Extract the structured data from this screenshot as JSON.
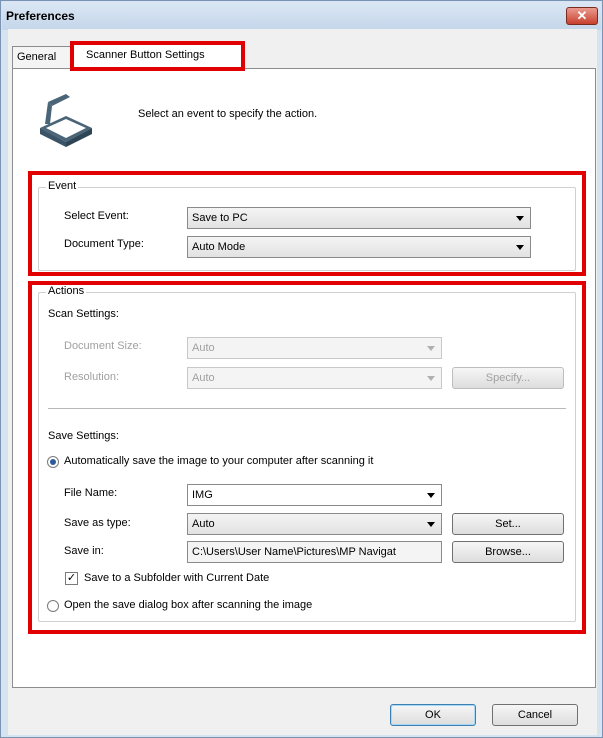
{
  "window": {
    "title": "Preferences",
    "close_glyph": "✕"
  },
  "tabs": [
    {
      "label": "General",
      "active": false
    },
    {
      "label": "Scanner Button Settings",
      "active": true
    }
  ],
  "intro": {
    "icon": "scanner-icon",
    "text": "Select an event to specify the action."
  },
  "event": {
    "group_title": "Event",
    "select_event_label": "Select Event:",
    "select_event_value": "Save to PC",
    "document_type_label": "Document Type:",
    "document_type_value": "Auto Mode"
  },
  "actions": {
    "group_title": "Actions",
    "scan_settings_label": "Scan Settings:",
    "document_size_label": "Document Size:",
    "document_size_value": "Auto",
    "resolution_label": "Resolution:",
    "resolution_value": "Auto",
    "specify_label": "Specify...",
    "save_settings_label": "Save Settings:",
    "auto_save_label": "Automatically save the image to your computer after scanning it",
    "file_name_label": "File Name:",
    "file_name_value": "IMG",
    "save_as_type_label": "Save as type:",
    "save_as_type_value": "Auto",
    "set_label": "Set...",
    "save_in_label": "Save in:",
    "save_in_value": "C:\\Users\\User Name\\Pictures\\MP Navigat",
    "browse_label": "Browse...",
    "subfolder_label": "Save to a Subfolder with Current Date",
    "subfolder_checked": true,
    "open_dialog_label": "Open the save dialog box after scanning the image"
  },
  "footer": {
    "ok_label": "OK",
    "cancel_label": "Cancel"
  },
  "colors": {
    "highlight": "#e00000",
    "window_frame": "#d6e3f1"
  }
}
